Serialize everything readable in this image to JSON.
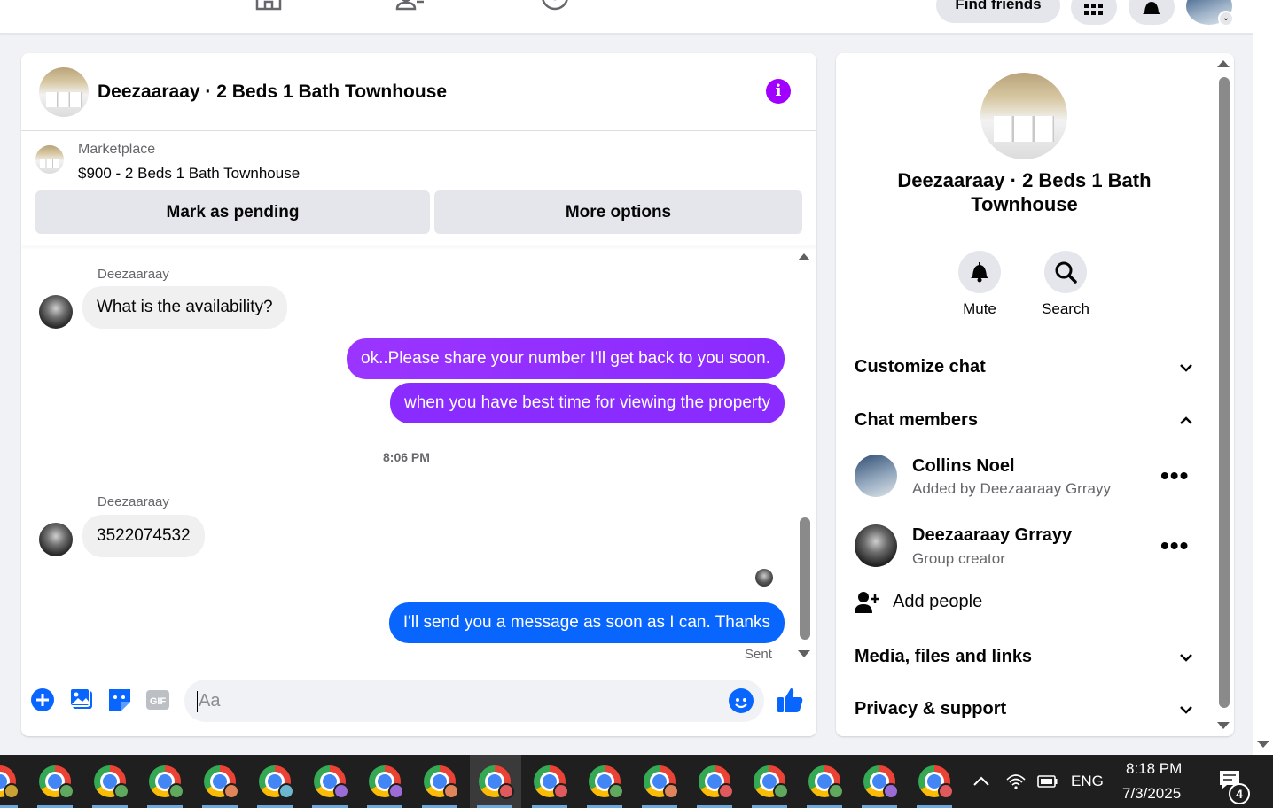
{
  "topnav": {
    "find_friends_label": "Find friends",
    "icons": [
      "home-icon",
      "friends-icon",
      "groups-icon",
      "menu-grid-icon",
      "notifications-icon",
      "account-icon"
    ]
  },
  "chat": {
    "title": "Deezaaraay · 2 Beds 1 Bath Townhouse",
    "marketplace": {
      "label": "Marketplace",
      "listing_title": "$900 - 2 Beds 1 Bath Townhouse",
      "mark_pending_label": "Mark as pending",
      "more_options_label": "More options"
    },
    "messages": [
      {
        "sender": "Deezaaraay",
        "text": "What is the availability?"
      },
      {
        "text": "ok..Please share your number I'll get back to you soon."
      },
      {
        "text": "when you have best time for viewing the property"
      },
      {
        "timestamp": "8:06 PM"
      },
      {
        "sender": "Deezaaraay",
        "text": "3522074532"
      },
      {
        "text": "I'll send you a message as soon as I can. Thanks",
        "status": "Sent"
      }
    ],
    "composer": {
      "placeholder": "Aa"
    },
    "colors": {
      "purple_bubble": "#a033ff",
      "blue_bubble": "#0866ff",
      "accent": "#0866ff"
    }
  },
  "info": {
    "name": "Deezaaraay · 2 Beds 1 Bath Townhouse",
    "mute_label": "Mute",
    "search_label": "Search",
    "sections": {
      "customize": "Customize chat",
      "members": "Chat members",
      "media": "Media, files and links",
      "privacy": "Privacy & support"
    },
    "members": [
      {
        "name": "Collins Noel",
        "sub": "Added by Deezaaraay Grrayy"
      },
      {
        "name": "Deezaaraay Grrayy",
        "sub": "Group creator"
      }
    ],
    "add_people_label": "Add people"
  },
  "taskbar": {
    "language": "ENG",
    "time": "8:18 PM",
    "date": "7/3/2025",
    "notification_count": "4"
  }
}
